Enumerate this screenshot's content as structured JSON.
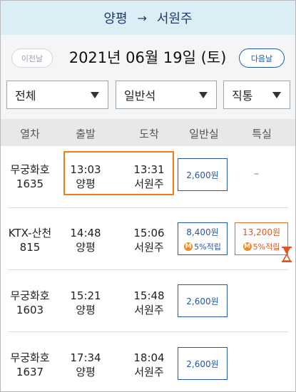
{
  "header": {
    "from": "양평",
    "arrow": "→",
    "to": "서원주"
  },
  "date_nav": {
    "prev_label": "이전날",
    "date": "2021년 06월 19일 (토)",
    "next_label": "다음날"
  },
  "filters": {
    "train_type": "전체",
    "seat_class": "일반석",
    "route_type": "직통"
  },
  "columns": [
    "열차",
    "출발",
    "도착",
    "일반실",
    "특실"
  ],
  "trains": [
    {
      "name": "무궁화호",
      "number": "1635",
      "dep_time": "13:03",
      "dep_station": "양평",
      "arr_time": "13:31",
      "arr_station": "서원주",
      "general_fare": "2,600원",
      "special": "–"
    },
    {
      "name": "KTX-산천",
      "number": "815",
      "dep_time": "14:48",
      "dep_station": "양평",
      "arr_time": "15:06",
      "arr_station": "서원주",
      "general_fare": "8,400원",
      "general_point": "5%적립",
      "special_fare": "13,200원",
      "special_point": "5%적립",
      "m_badge": "M"
    },
    {
      "name": "무궁화호",
      "number": "1603",
      "dep_time": "15:21",
      "dep_station": "양평",
      "arr_time": "15:48",
      "arr_station": "서원주",
      "general_fare": "2,600원"
    },
    {
      "name": "무궁화호",
      "number": "1637",
      "dep_time": "17:34",
      "dep_station": "양평",
      "arr_time": "18:04",
      "arr_station": "서원주",
      "general_fare": "2,600원"
    }
  ],
  "colors": {
    "accent_blue": "#2457a4",
    "selection_orange": "#f07d16",
    "header_bg": "#dbeef5"
  }
}
